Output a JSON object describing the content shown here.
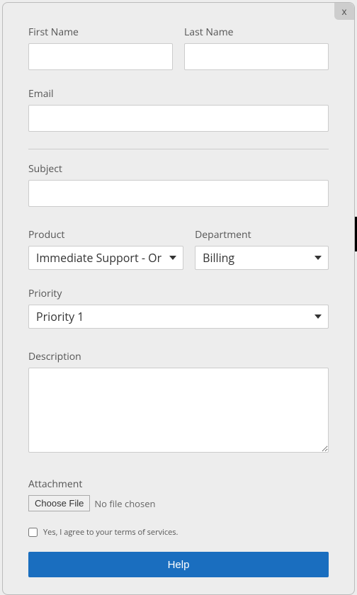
{
  "close": "x",
  "labels": {
    "first_name": "First Name",
    "last_name": "Last Name",
    "email": "Email",
    "subject": "Subject",
    "product": "Product",
    "department": "Department",
    "priority": "Priority",
    "description": "Description",
    "attachment": "Attachment"
  },
  "values": {
    "first_name": "",
    "last_name": "",
    "email": "",
    "subject": "",
    "product": "Immediate Support - Or",
    "department": "Billing",
    "priority": "Priority 1",
    "description": ""
  },
  "file": {
    "button": "Choose File",
    "status": "No file chosen"
  },
  "terms": {
    "label": "Yes, I agree to your terms of services.",
    "checked": false
  },
  "submit": "Help"
}
